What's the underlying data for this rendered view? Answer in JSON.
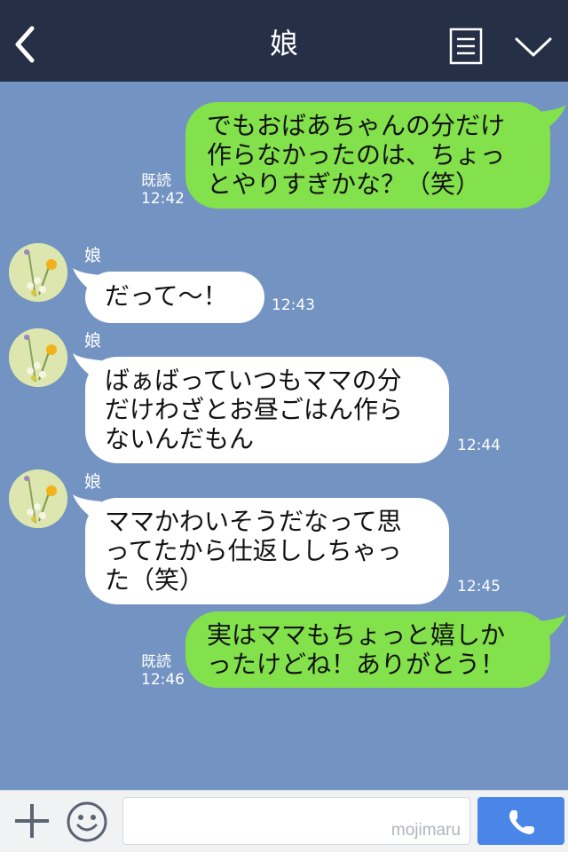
{
  "header": {
    "title": "娘"
  },
  "colors": {
    "background": "#7393c2",
    "header": "#252f45",
    "sent_bubble": "#83e14b",
    "received_bubble": "#ffffff",
    "call_button": "#4a86e8"
  },
  "messages": [
    {
      "direction": "sent",
      "lines": [
        "でもおばあちゃんの分だけ",
        "作らなかったのは、ちょっ",
        "とやりすぎかな？（笑）"
      ],
      "read_label": "既読",
      "time": "12:42"
    },
    {
      "direction": "received",
      "sender": "娘",
      "lines": [
        "だって〜！"
      ],
      "time": "12:43"
    },
    {
      "direction": "received",
      "sender": "娘",
      "lines": [
        "ばぁばっていつもママの分",
        "だけわざとお昼ごはん作ら",
        "ないんだもん"
      ],
      "time": "12:44"
    },
    {
      "direction": "received",
      "sender": "娘",
      "lines": [
        "ママかわいそうだなって思",
        "ってたから仕返ししちゃっ",
        "た（笑）"
      ],
      "time": "12:45"
    },
    {
      "direction": "sent",
      "lines": [
        "実はママもちょっと嬉しか",
        "ったけどね！ありがとう！"
      ],
      "read_label": "既読",
      "time": "12:46"
    }
  ],
  "input_bar": {
    "placeholder": "",
    "watermark": "mojimaru"
  },
  "icons": {
    "back": "back-arrow-icon",
    "menu": "menu-list-icon",
    "expand": "chevron-down-icon",
    "add": "plus-icon",
    "emoji": "emoji-icon",
    "call": "phone-icon"
  }
}
